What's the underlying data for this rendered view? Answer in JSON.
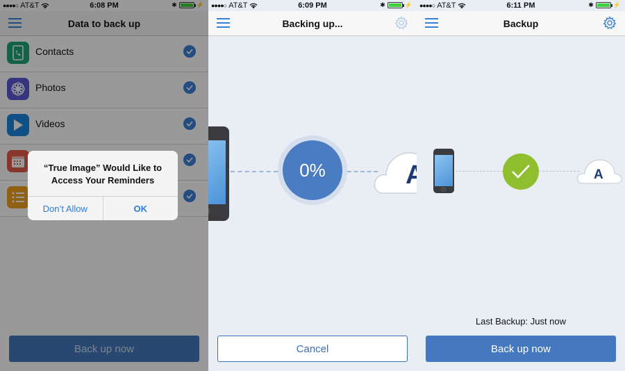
{
  "colors": {
    "accent": "#3b7fd4",
    "button_blue": "#4478bf",
    "success_green": "#8fbf2e",
    "background": "#e9edf4"
  },
  "screen1": {
    "status": {
      "carrier": "AT&T",
      "time": "6:08 PM"
    },
    "title": "Data to back up",
    "items": [
      {
        "label": "Contacts",
        "icon": "contacts-icon",
        "color": "#1fa37a"
      },
      {
        "label": "Photos",
        "icon": "photos-icon",
        "color": "#5b5bd6"
      },
      {
        "label": "Videos",
        "icon": "videos-icon",
        "color": "#1b86e0"
      },
      {
        "label": "",
        "icon": "calendar-icon",
        "color": "#e35a4a"
      },
      {
        "label": "",
        "icon": "reminders-icon",
        "color": "#f0a020"
      }
    ],
    "alert": {
      "message": "“True Image” Would Like to\nAccess Your Reminders",
      "dont_allow": "Don’t Allow",
      "ok": "OK"
    },
    "button": "Back up now"
  },
  "screen2": {
    "status": {
      "carrier": "AT&T",
      "time": "6:09 PM"
    },
    "title": "Backing up...",
    "progress": "0%",
    "cloud_letter": "A",
    "button": "Cancel"
  },
  "screen3": {
    "status": {
      "carrier": "AT&T",
      "time": "6:11 PM"
    },
    "title": "Backup",
    "cloud_letter": "A",
    "last_backup": "Last Backup: Just now",
    "button": "Back up now"
  }
}
